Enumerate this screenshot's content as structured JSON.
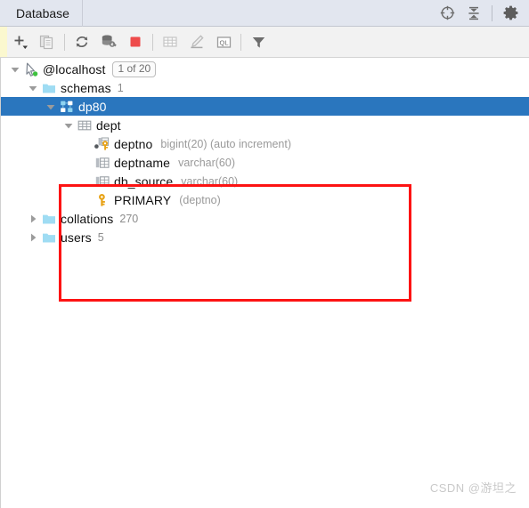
{
  "window": {
    "tab_label": "Database",
    "header_actions": [
      {
        "name": "scroll-from-source-icon",
        "title": "Scroll from Source"
      },
      {
        "name": "collapse-all-icon",
        "title": "Collapse All"
      },
      {
        "name": "gear-icon",
        "title": "Settings"
      }
    ]
  },
  "toolbar": {
    "buttons": [
      {
        "name": "add-icon",
        "title": "New",
        "enabled": true
      },
      {
        "name": "copy-icon",
        "title": "Duplicate",
        "enabled": false
      },
      {
        "name": "refresh-icon",
        "title": "Refresh",
        "enabled": true
      },
      {
        "name": "data-source-properties-icon",
        "title": "Data Source Properties",
        "enabled": true
      },
      {
        "name": "stop-icon",
        "title": "Stop",
        "enabled": true
      },
      {
        "name": "table-editor-icon",
        "title": "Open Table Editor",
        "enabled": false
      },
      {
        "name": "edit-icon",
        "title": "Modify",
        "enabled": false
      },
      {
        "name": "query-console-icon",
        "title": "Open Query Console",
        "enabled": false
      },
      {
        "name": "filter-icon",
        "title": "Filter",
        "enabled": true
      }
    ],
    "query_console_glyph": "QL"
  },
  "tree": {
    "nodes": [
      {
        "id": "localhost",
        "label": "@localhost",
        "icon": "connection-cursor-icon",
        "badge": "1 of 20",
        "expanded": true,
        "indent": 0,
        "selected": false
      },
      {
        "id": "schemas",
        "label": "schemas",
        "icon": "folder-icon",
        "meta": "1",
        "expanded": true,
        "indent": 1,
        "selected": false
      },
      {
        "id": "dp80",
        "label": "dp80",
        "icon": "schema-icon",
        "expanded": true,
        "indent": 2,
        "selected": true
      },
      {
        "id": "dept",
        "label": "dept",
        "icon": "table-icon",
        "expanded": true,
        "indent": 3,
        "selected": false
      },
      {
        "id": "deptno",
        "label": "deptno",
        "icon": "primary-key-column-icon",
        "type": "bigint(20) (auto increment)",
        "indent": 4,
        "selected": false
      },
      {
        "id": "deptname",
        "label": "deptname",
        "icon": "column-icon",
        "type": "varchar(60)",
        "indent": 4,
        "selected": false
      },
      {
        "id": "db_source",
        "label": "db_source",
        "icon": "column-icon",
        "type": "varchar(60)",
        "indent": 4,
        "selected": false
      },
      {
        "id": "primary",
        "label": "PRIMARY",
        "icon": "key-icon",
        "type": "(deptno)",
        "indent": 4,
        "selected": false
      },
      {
        "id": "collations",
        "label": "collations",
        "icon": "folder-icon",
        "meta": "270",
        "expanded": false,
        "indent": 1,
        "selected": false
      },
      {
        "id": "users",
        "label": "users",
        "icon": "folder-icon",
        "meta": "5",
        "expanded": false,
        "indent": 1,
        "selected": false
      }
    ]
  },
  "annotation": {
    "color": "#fd1313",
    "shape": "rectangle"
  },
  "watermark": {
    "text": "CSDN @游坦之"
  },
  "colors": {
    "selection_blue": "#2a76be",
    "header_bg": "#e2e6ef",
    "toolbar_bg": "#f2f2f2",
    "annotation_red": "#fd1313",
    "folder_blue": "#9fdcf3",
    "key_gold": "#e8a317",
    "stop_red": "#ee4b4b"
  }
}
